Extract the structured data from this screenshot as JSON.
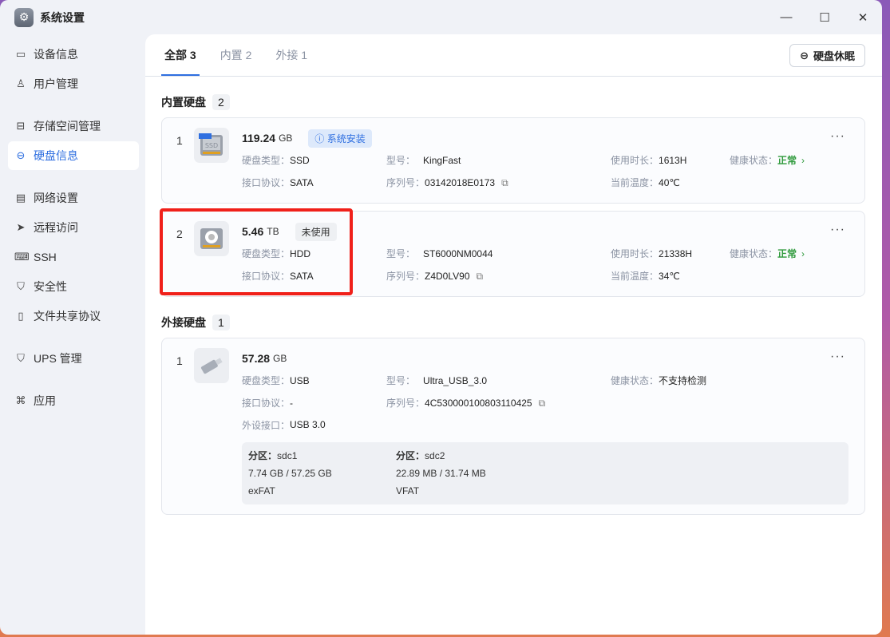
{
  "app": {
    "title": "系统设置",
    "icon": "gear-icon"
  },
  "window_controls": {
    "minimize": "—",
    "maximize": "☐",
    "close": "✕"
  },
  "sidebar": {
    "items": [
      {
        "label": "设备信息",
        "icon": "device-icon"
      },
      {
        "label": "用户管理",
        "icon": "user-settings-icon"
      },
      {
        "label": "存储空间管理",
        "icon": "storage-icon"
      },
      {
        "label": "硬盘信息",
        "icon": "disk-icon"
      },
      {
        "label": "网络设置",
        "icon": "network-icon"
      },
      {
        "label": "远程访问",
        "icon": "send-icon"
      },
      {
        "label": "SSH",
        "icon": "code-icon"
      },
      {
        "label": "安全性",
        "icon": "shield-icon"
      },
      {
        "label": "文件共享协议",
        "icon": "file-icon"
      },
      {
        "label": "UPS 管理",
        "icon": "ups-icon"
      },
      {
        "label": "应用",
        "icon": "apps-icon"
      }
    ]
  },
  "tabs": [
    {
      "label": "全部 3"
    },
    {
      "label": "内置 2"
    },
    {
      "label": "外接 1"
    }
  ],
  "sleep_button": "硬盘休眠",
  "labels": {
    "type": "硬盘类型：",
    "iface": "接口协议：",
    "model": "型号：",
    "serial": "序列号：",
    "hours": "使用时长：",
    "health": "健康状态：",
    "temp": "当前温度：",
    "ext_port": "外设接口：",
    "partition": "分区："
  },
  "internal": {
    "title": "内置硬盘",
    "count": "2",
    "disks": [
      {
        "index": "1",
        "size": "119.24",
        "unit": "GB",
        "tag": "系统安装",
        "type": "SSD",
        "iface": "SATA",
        "model": "KingFast",
        "serial": "03142018E0173",
        "hours": "1613H",
        "health": "正常",
        "temp": "40℃"
      },
      {
        "index": "2",
        "size": "5.46",
        "unit": "TB",
        "tag": "未使用",
        "type": "HDD",
        "iface": "SATA",
        "model": "ST6000NM0044",
        "serial": "Z4D0LV90",
        "hours": "21338H",
        "health": "正常",
        "temp": "34℃"
      }
    ]
  },
  "external": {
    "title": "外接硬盘",
    "count": "1",
    "disks": [
      {
        "index": "1",
        "size": "57.28",
        "unit": "GB",
        "type": "USB",
        "iface": "-",
        "model": "Ultra_USB_3.0",
        "serial": "4C530000100803110425",
        "health": "不支持检测",
        "port": "USB 3.0",
        "partitions": [
          {
            "name": "sdc1",
            "usage": "7.74 GB / 57.25 GB",
            "fs": "exFAT"
          },
          {
            "name": "sdc2",
            "usage": "22.89 MB / 31.74 MB",
            "fs": "VFAT"
          }
        ]
      }
    ]
  }
}
